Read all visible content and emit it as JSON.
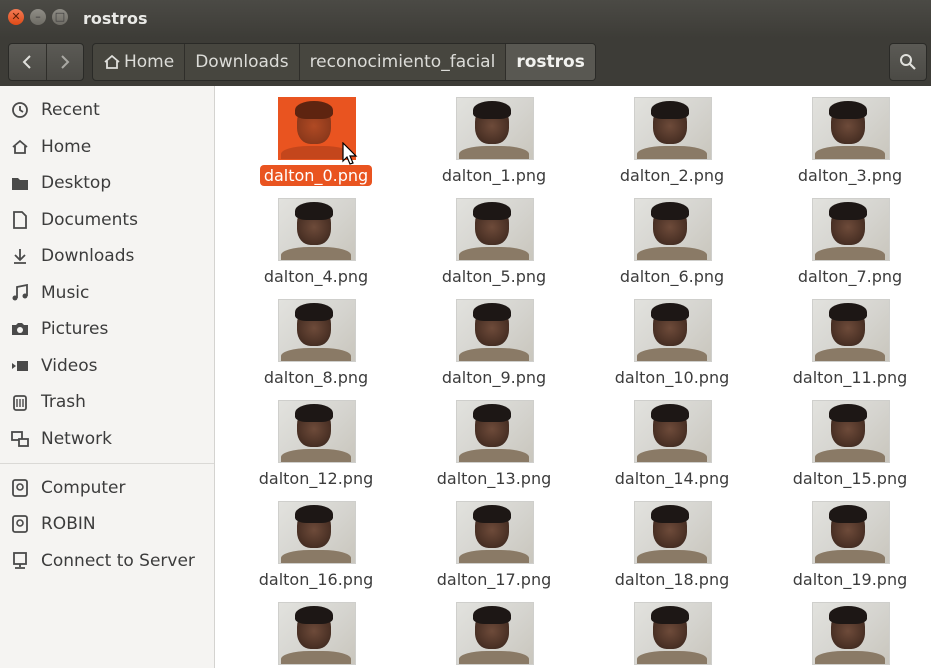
{
  "window": {
    "title": "rostros"
  },
  "toolbar": {
    "breadcrumbs": [
      "Home",
      "Downloads",
      "reconocimiento_facial",
      "rostros"
    ]
  },
  "sidebar": {
    "places": [
      {
        "label": "Recent",
        "icon": "clock-icon"
      },
      {
        "label": "Home",
        "icon": "home-icon"
      },
      {
        "label": "Desktop",
        "icon": "folder-icon"
      },
      {
        "label": "Documents",
        "icon": "document-icon"
      },
      {
        "label": "Downloads",
        "icon": "download-icon"
      },
      {
        "label": "Music",
        "icon": "music-icon"
      },
      {
        "label": "Pictures",
        "icon": "camera-icon"
      },
      {
        "label": "Videos",
        "icon": "video-icon"
      },
      {
        "label": "Trash",
        "icon": "trash-icon"
      },
      {
        "label": "Network",
        "icon": "network-icon"
      }
    ],
    "devices": [
      {
        "label": "Computer",
        "icon": "drive-icon"
      },
      {
        "label": "ROBIN",
        "icon": "drive-icon"
      },
      {
        "label": "Connect to Server",
        "icon": "server-icon"
      }
    ]
  },
  "files": [
    "dalton_0.png",
    "dalton_1.png",
    "dalton_2.png",
    "dalton_3.png",
    "dalton_4.png",
    "dalton_5.png",
    "dalton_6.png",
    "dalton_7.png",
    "dalton_8.png",
    "dalton_9.png",
    "dalton_10.png",
    "dalton_11.png",
    "dalton_12.png",
    "dalton_13.png",
    "dalton_14.png",
    "dalton_15.png",
    "dalton_16.png",
    "dalton_17.png",
    "dalton_18.png",
    "dalton_19.png",
    "",
    "",
    "",
    ""
  ],
  "selected_file": "dalton_0.png",
  "colors": {
    "accent": "#e95420",
    "titlebar": "#3d3c37",
    "sidebar_bg": "#f5f4f2"
  }
}
